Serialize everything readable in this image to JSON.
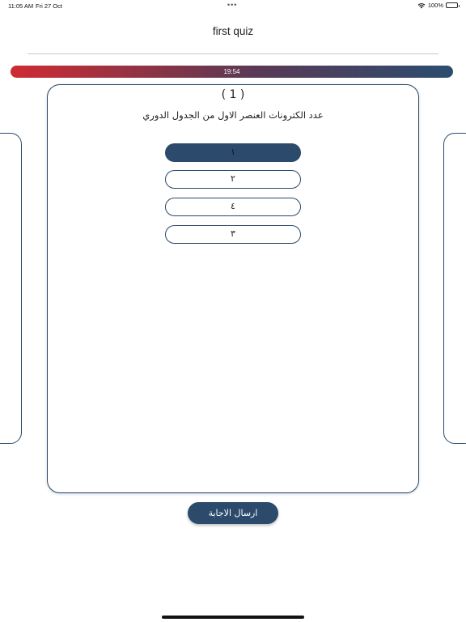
{
  "status_bar": {
    "time": "11:05 AM",
    "date": "Fri 27 Oct",
    "dots": "•••",
    "battery_text": "100%"
  },
  "header": {
    "title": "first quiz"
  },
  "timer": {
    "text": "19:54",
    "gradient_start": "#cf2b33",
    "gradient_end": "#2c4d6e"
  },
  "question": {
    "number": "( 1 )",
    "text": "عدد الكترونات العنصر الاول من الجدول الدوري",
    "answers": [
      {
        "label": "١",
        "selected": true
      },
      {
        "label": "٢",
        "selected": false
      },
      {
        "label": "٤",
        "selected": false
      },
      {
        "label": "٣",
        "selected": false
      }
    ]
  },
  "submit": {
    "label": "ارسال الاجابة"
  },
  "colors": {
    "accent": "#2c4a6c",
    "border": "#2c4a68"
  },
  "icons": {
    "wifi": "wifi-icon",
    "battery": "battery-icon"
  }
}
